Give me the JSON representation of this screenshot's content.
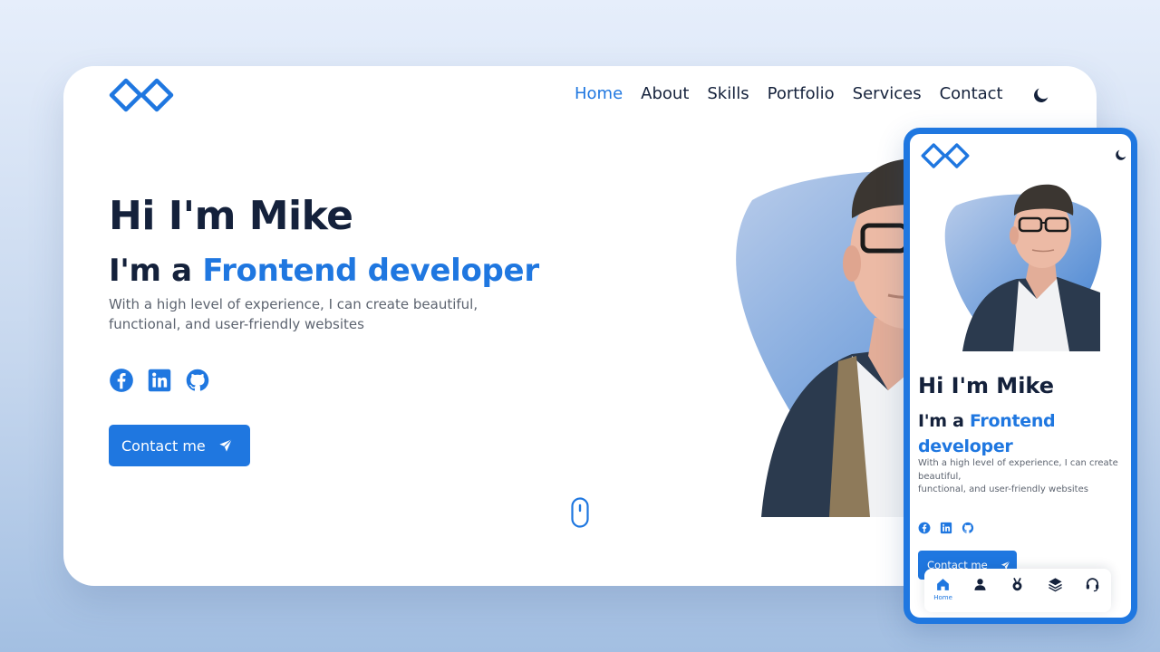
{
  "colors": {
    "accent": "#1f77e0",
    "text": "#14213b",
    "muted": "#5d6470",
    "blob_light": "#b9ccea",
    "blob_dark": "#3e7fd0"
  },
  "desktop": {
    "logo_icon": "infinity-diamonds-logo-icon",
    "nav": [
      {
        "label": "Home",
        "active": true
      },
      {
        "label": "About"
      },
      {
        "label": "Skills"
      },
      {
        "label": "Portfolio"
      },
      {
        "label": "Services"
      },
      {
        "label": "Contact"
      }
    ],
    "theme_icon": "moon-icon",
    "hero": {
      "title": "Hi I'm Mike",
      "subtitle_prefix": "I'm a ",
      "subtitle_highlight": "Frontend developer",
      "description": "With a high level of experience, I can create beautiful, functional, and user-friendly websites"
    },
    "socials": [
      "facebook-icon",
      "linkedin-icon",
      "github-icon"
    ],
    "cta_label": "Contact me",
    "cta_icon": "send-icon",
    "scroll_icon": "mouse-scroll-icon"
  },
  "mobile": {
    "hero": {
      "title": "Hi I'm Mike",
      "subtitle_prefix": "I'm a ",
      "subtitle_highlight": "Frontend developer",
      "description_line1": "With a high level of experience, I can create beautiful,",
      "description_line2": "functional, and user-friendly websites"
    },
    "cta_label": "Contact me",
    "tabbar": [
      {
        "icon": "home-icon",
        "label": "Home",
        "active": true
      },
      {
        "icon": "user-icon"
      },
      {
        "icon": "medal-icon"
      },
      {
        "icon": "layers-icon"
      },
      {
        "icon": "headset-icon"
      }
    ]
  }
}
